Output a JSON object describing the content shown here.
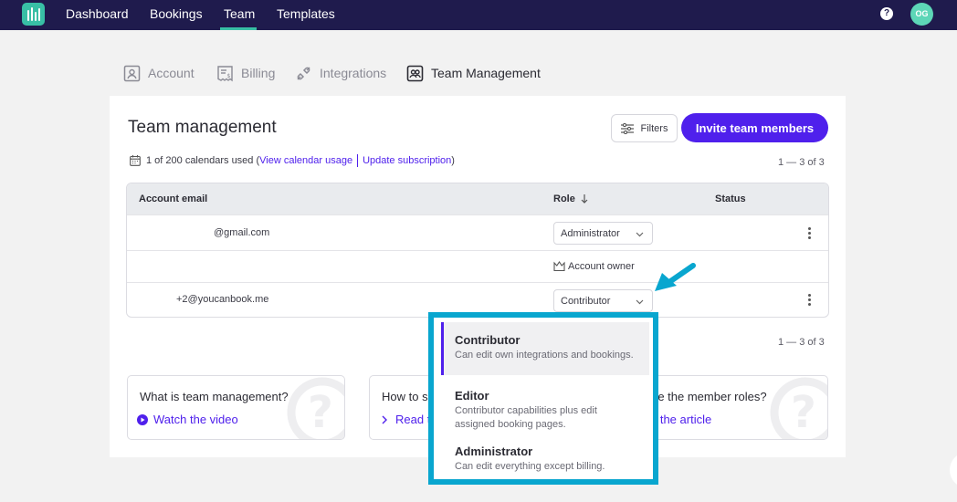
{
  "nav": {
    "items": [
      "Dashboard",
      "Bookings",
      "Team",
      "Templates"
    ],
    "active": "Team",
    "help": "?",
    "avatar_initials": "OG"
  },
  "tabs": [
    "Account",
    "Billing",
    "Integrations",
    "Team Management"
  ],
  "active_tab": "Team Management",
  "panel": {
    "title": "Team management",
    "filters_label": "Filters",
    "invite_label": "Invite team members",
    "usage_text": "1 of 200 calendars used (",
    "view_usage_link": "View calendar usage",
    "update_link": "Update subscription",
    "usage_close": ")",
    "pager_top": "1 — 3 of 3",
    "pager_bottom": "1 — 3 of 3"
  },
  "table": {
    "headers": {
      "email": "Account email",
      "role": "Role",
      "status": "Status"
    },
    "rows": [
      {
        "email": "@gmail.com",
        "role": "Administrator"
      },
      {
        "email": "",
        "role_text": "Account owner"
      },
      {
        "email": "+2@youcanbook.me",
        "role": "Contributor"
      }
    ]
  },
  "cards": [
    {
      "question": "What is team management?",
      "action": "Watch the video"
    },
    {
      "question": "How to s",
      "action": "Read t"
    },
    {
      "question": "re the member roles?",
      "action": "d the article"
    }
  ],
  "dropdown": {
    "options": [
      {
        "name": "Contributor",
        "desc": "Can edit own integrations and bookings.",
        "selected": true
      },
      {
        "name": "Editor",
        "desc": "Contributor capabilities plus edit assigned booking pages.",
        "selected": false
      },
      {
        "name": "Administrator",
        "desc": "Can edit everything except billing.",
        "selected": false
      }
    ]
  },
  "colors": {
    "nav_bg": "#1f1b4d",
    "accent": "#4f20ec",
    "teal": "#38bfa5",
    "highlight": "#09a6cf"
  }
}
